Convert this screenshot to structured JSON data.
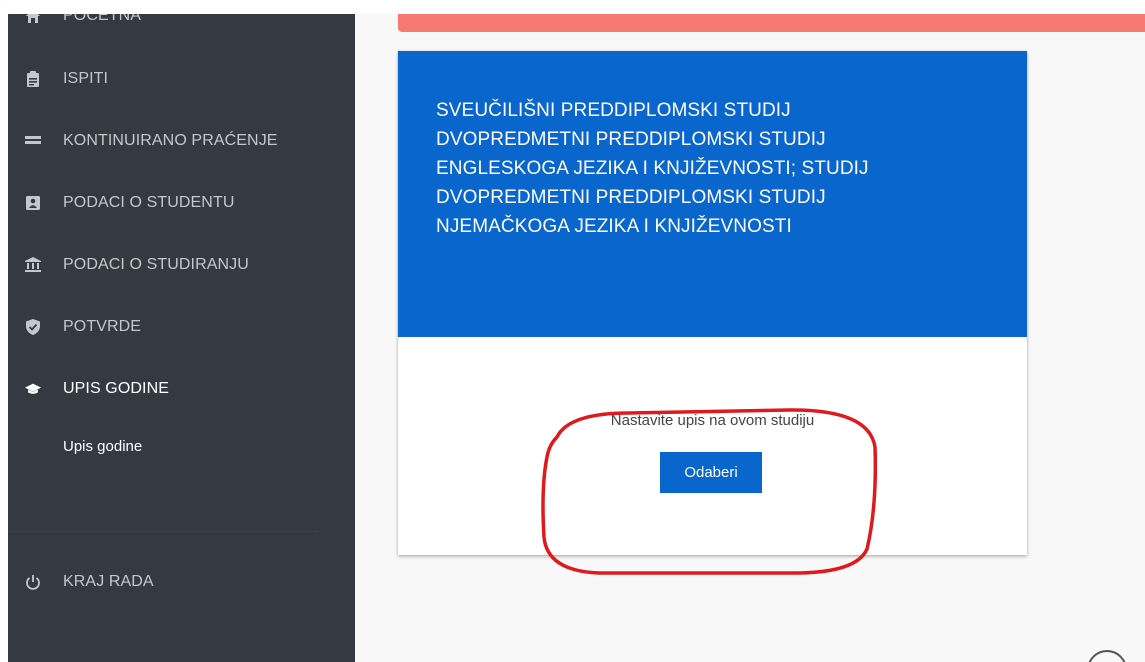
{
  "sidebar": {
    "items": [
      {
        "label": "Početna",
        "icon": "home-icon"
      },
      {
        "label": "Ispiti",
        "icon": "clipboard-icon"
      },
      {
        "label": "Kontinuirano praćenje",
        "icon": "list-icon"
      },
      {
        "label": "Podaci o studentu",
        "icon": "contact-card-icon"
      },
      {
        "label": "Podaci o studiranju",
        "icon": "institution-icon"
      },
      {
        "label": "Potvrde",
        "icon": "shield-check-icon"
      },
      {
        "label": "Upis godine",
        "icon": "graduation-cap-icon"
      }
    ],
    "subitem": "Upis godine",
    "logout": {
      "label": "Kraj rada",
      "icon": "power-icon"
    }
  },
  "card": {
    "study_lines": [
      "SVEUČILIŠNI PREDDIPLOMSKI STUDIJ",
      "DVOPREDMETNI PREDDIPLOMSKI STUDIJ",
      "ENGLESKOGA JEZIKA I KNJIŽEVNOSTI; STUDIJ",
      "DVOPREDMETNI PREDDIPLOMSKI STUDIJ",
      "NJEMAČKOGA JEZIKA I KNJIŽEVNOSTI"
    ],
    "continue_text": "Nastavite upis na ovom studiju",
    "select_button": "Odaberi"
  },
  "colors": {
    "sidebar_bg": "#333a42",
    "brand_blue": "#0866cc",
    "alert_bar": "#f47a72",
    "annotation_red": "#e0191e"
  }
}
